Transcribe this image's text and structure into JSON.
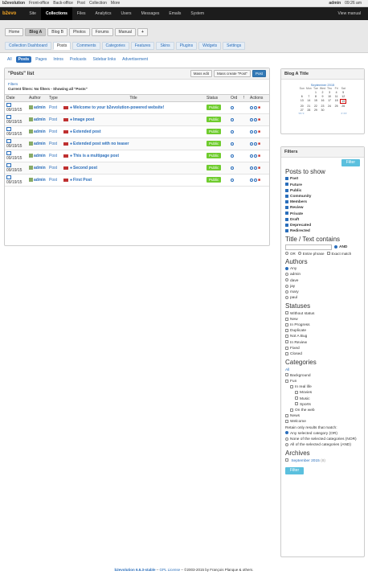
{
  "topbar": {
    "brand": "b2evolution",
    "links": [
      "Front-office",
      "Back-office",
      "Post",
      "Collection",
      "More"
    ],
    "user": "admin",
    "time": "09:26 am"
  },
  "nav": {
    "logo": "b2evo",
    "items": [
      "Site",
      "Collections",
      "Files",
      "Analytics",
      "Users",
      "Messages",
      "Emails",
      "System"
    ],
    "active": "Collections",
    "right": "View manual"
  },
  "blog_tabs": [
    "Home",
    "Blog A",
    "Blog B",
    "Photos",
    "Forums",
    "Manual",
    "+"
  ],
  "coll_tabs": [
    "Collection Dashboard",
    "Posts",
    "Comments",
    "Categories",
    "Features",
    "Skins",
    "Plugins",
    "Widgets",
    "Settings"
  ],
  "type_tabs": [
    "All",
    "Posts",
    "Pages",
    "Intros",
    "Podcasts",
    "Sidebar links",
    "Advertisement"
  ],
  "list": {
    "title": "\"Posts\" list",
    "mass_edit": "Mass edit",
    "mass_create": "Mass create \"Post\"",
    "post_btn": "Post",
    "filters_label": "Filters",
    "current_filters": "Current filters: No filters - Showing all \"Posts\"",
    "columns": [
      "Date",
      "Author",
      "Type",
      "Title",
      "Status",
      "Ord",
      "!",
      "Actions"
    ],
    "rows": [
      {
        "date": "09/19/15",
        "author": "admin",
        "type": "Post",
        "title": "Welcome to your b2evolution-powered website!",
        "status": "Public"
      },
      {
        "date": "09/19/15",
        "author": "admin",
        "type": "Post",
        "title": "Image post",
        "status": "Public"
      },
      {
        "date": "09/19/15",
        "author": "admin",
        "type": "Post",
        "title": "Extended post",
        "status": "Public"
      },
      {
        "date": "09/19/15",
        "author": "admin",
        "type": "Post",
        "title": "Extended post with no teaser",
        "status": "Public"
      },
      {
        "date": "09/19/15",
        "author": "admin",
        "type": "Post",
        "title": "This is a multipage post",
        "status": "Public"
      },
      {
        "date": "09/19/15",
        "author": "admin",
        "type": "Post",
        "title": "Second post",
        "status": "Public"
      },
      {
        "date": "09/19/15",
        "author": "admin",
        "type": "Post",
        "title": "First Post",
        "status": "Public"
      }
    ]
  },
  "sidebar": {
    "title_box": "Blog A Title",
    "calendar": {
      "month": "September 2015",
      "days": [
        "Sun",
        "Mon",
        "Tue",
        "Wed",
        "Thu",
        "Fri",
        "Sat"
      ],
      "cells": [
        "",
        "",
        "1",
        "2",
        "3",
        "4",
        "5",
        "6",
        "7",
        "8",
        "9",
        "10",
        "11",
        "12",
        "13",
        "14",
        "15",
        "16",
        "17",
        "18",
        "19",
        "20",
        "21",
        "22",
        "23",
        "24",
        "25",
        "26",
        "27",
        "28",
        "29",
        "30",
        "",
        "",
        ""
      ],
      "prev": "<< <",
      "next": "> >>"
    },
    "filters_box": "Filters",
    "filter_btn": "Filter",
    "posts_to_show": {
      "heading": "Posts to show",
      "items": [
        "Past",
        "Future",
        "Public",
        "Community",
        "Members",
        "Review",
        "Private",
        "Draft",
        "Deprecated",
        "Redirected"
      ]
    },
    "title_text": {
      "heading": "Title / Text contains",
      "and": "AND",
      "or": "OR",
      "phrase": "Entire phrase",
      "exact": "Exact match"
    },
    "authors": {
      "heading": "Authors",
      "items": [
        "Any",
        "admin",
        "dave",
        "jay",
        "mary",
        "paul"
      ]
    },
    "statuses": {
      "heading": "Statuses",
      "items": [
        "Without status",
        "New",
        "In Progress",
        "Duplicate",
        "Not A Bug",
        "In Review",
        "Fixed",
        "Closed"
      ]
    },
    "categories": {
      "heading": "Categories",
      "all": "All",
      "items": [
        "Background",
        "Fun",
        "In real life",
        "Movies",
        "Music",
        "Sports",
        "On the web",
        "News",
        "Welcome"
      ],
      "retain": "Retain only results that match:",
      "modes": [
        "Any selected category (OR)",
        "None of the selected categories (NOR)",
        "All of the selected categories (AND)"
      ]
    },
    "archives": {
      "heading": "Archives",
      "items": [
        "September 2015"
      ],
      "count": "(8)"
    }
  },
  "footer": {
    "product": "b2evolution 6.6.3-stable",
    "license": "GPL License",
    "copy": "©2003-2015 by François Planque & others."
  }
}
